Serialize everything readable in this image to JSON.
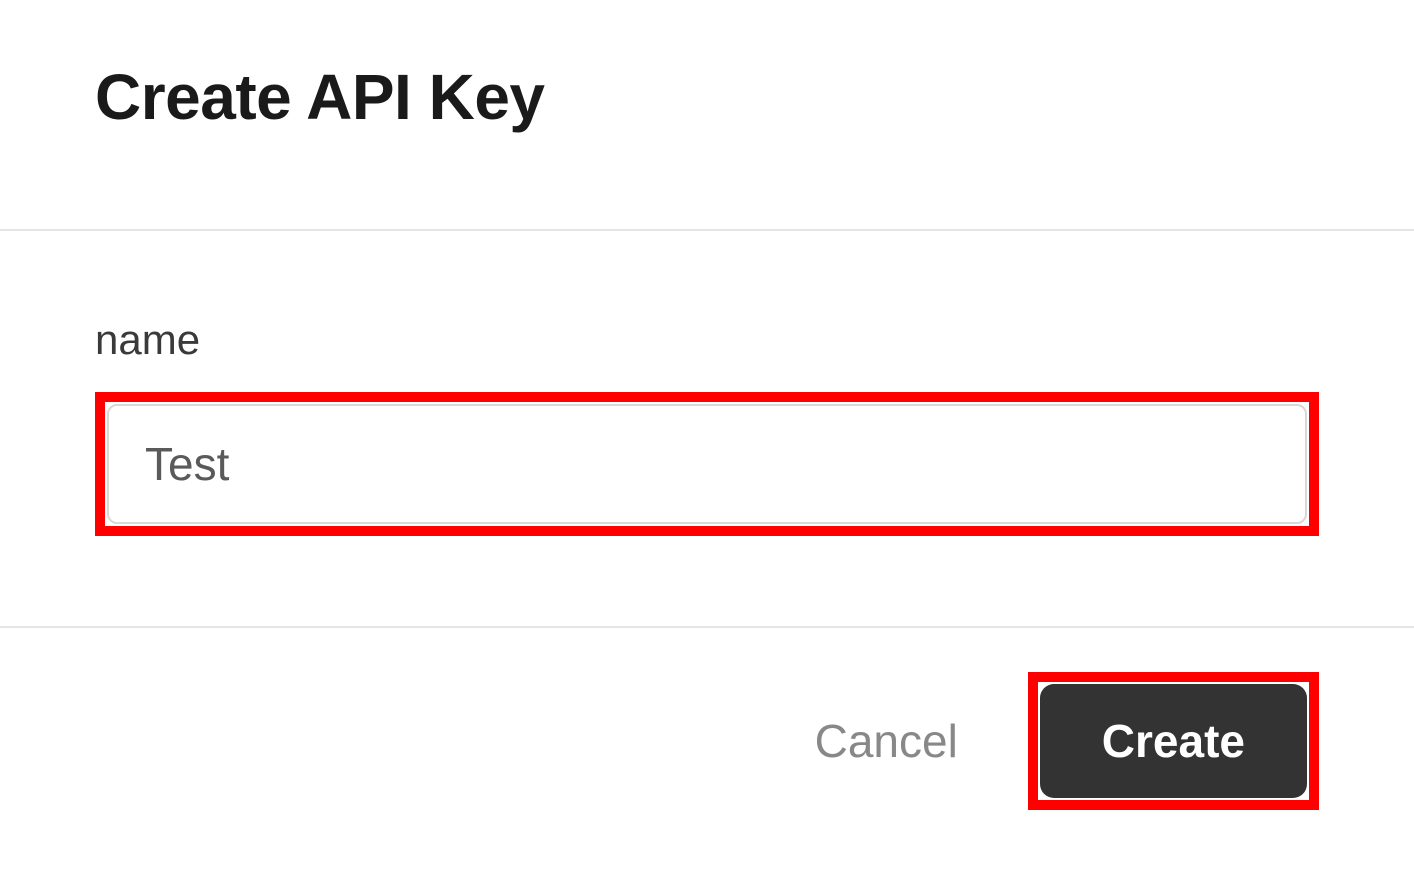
{
  "dialog": {
    "title": "Create API Key",
    "field": {
      "label": "name",
      "value": "Test"
    },
    "actions": {
      "cancel_label": "Cancel",
      "create_label": "Create"
    }
  },
  "annotations": {
    "highlight_color": "#ff0000",
    "highlighted_elements": [
      "name-input",
      "create-button"
    ]
  }
}
